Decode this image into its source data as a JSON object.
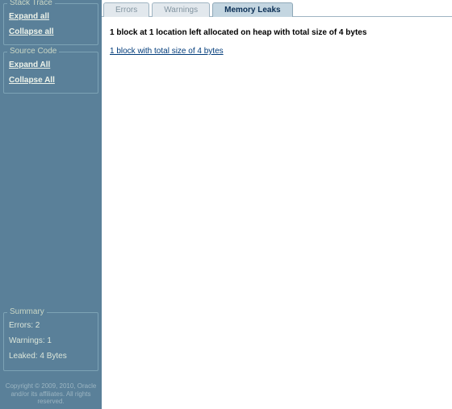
{
  "sidebar": {
    "stack_trace": {
      "title": "Stack Trace",
      "expand": "Expand all",
      "collapse": "Collapse all"
    },
    "source_code": {
      "title": "Source Code",
      "expand": "Expand All",
      "collapse": "Collapse All"
    },
    "summary": {
      "title": "Summary",
      "errors": "Errors: 2",
      "warnings": "Warnings: 1",
      "leaked": "Leaked: 4 Bytes"
    },
    "copyright": "Copyright © 2009, 2010, Oracle and/or its affiliates. All rights reserved."
  },
  "tabs": {
    "errors": "Errors",
    "warnings": "Warnings",
    "memory_leaks": "Memory Leaks"
  },
  "content": {
    "heading": "1 block at 1 location left allocated on heap with total size of 4 bytes",
    "link": "1 block with total size of 4 bytes"
  }
}
